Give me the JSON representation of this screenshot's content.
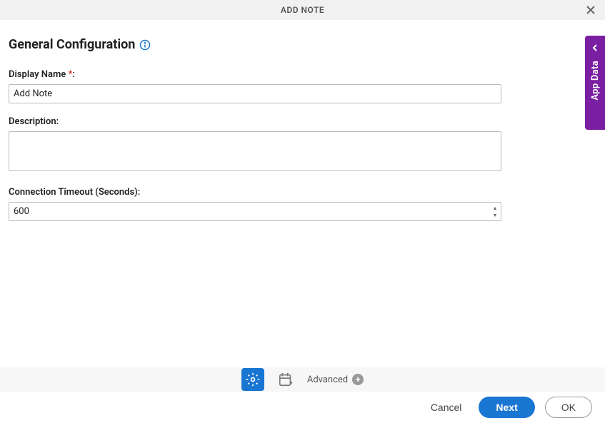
{
  "header": {
    "title": "ADD NOTE"
  },
  "section": {
    "title": "General Configuration"
  },
  "fields": {
    "displayName": {
      "label": "Display Name",
      "required": "*",
      "colon": ":",
      "value": "Add Note"
    },
    "description": {
      "label": "Description:",
      "value": ""
    },
    "connectionTimeout": {
      "label": "Connection Timeout (Seconds):",
      "value": "600"
    }
  },
  "toolbar": {
    "advanced": "Advanced"
  },
  "footer": {
    "cancel": "Cancel",
    "next": "Next",
    "ok": "OK"
  },
  "sideTab": {
    "label": "App Data"
  }
}
